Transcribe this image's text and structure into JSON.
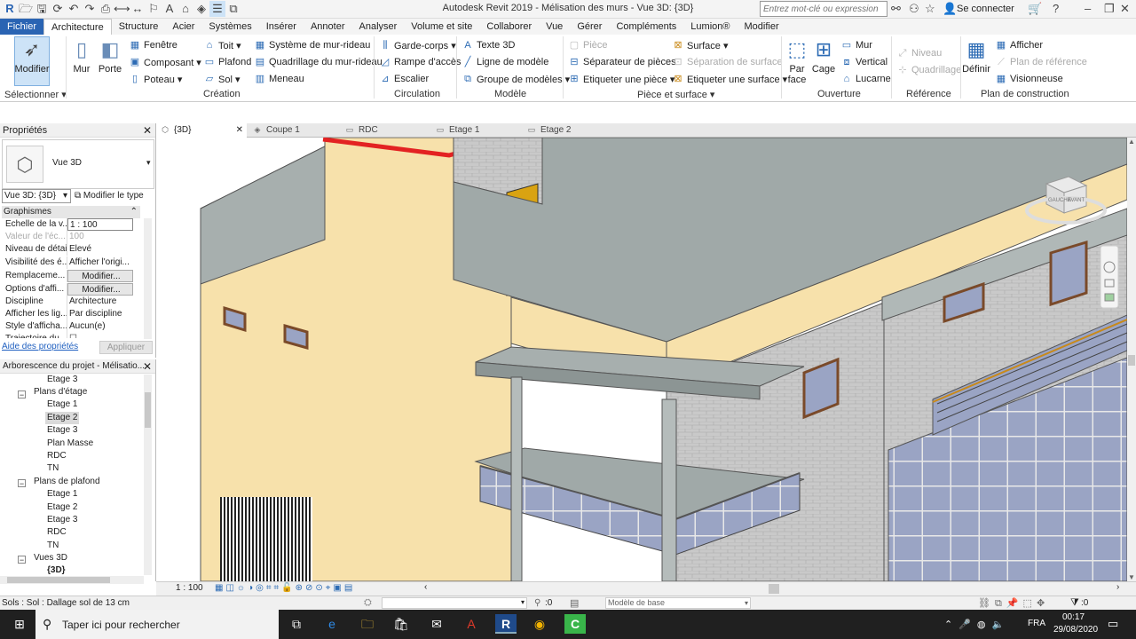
{
  "app": {
    "title": "Autodesk Revit 2019 - Mélisation des murs - Vue 3D: {3D}",
    "search_placeholder": "Entrez mot-clé ou expression",
    "signin": "Se connecter"
  },
  "menu_tabs": [
    "Fichier",
    "Architecture",
    "Structure",
    "Acier",
    "Systèmes",
    "Insérer",
    "Annoter",
    "Analyser",
    "Volume et site",
    "Collaborer",
    "Vue",
    "Gérer",
    "Compléments",
    "Lumion®",
    "Modifier"
  ],
  "ribbon": {
    "select": {
      "modify": "Modifier",
      "label": "Sélectionner ▾"
    },
    "build": {
      "wall": "Mur",
      "door": "Porte",
      "window": "Fenêtre",
      "component": "Composant ▾",
      "column": "Poteau ▾",
      "roof": "Toit ▾",
      "ceiling": "Plafond",
      "floor": "Sol ▾",
      "curtain_system": "Système de mur-rideau",
      "curtain_grid": "Quadrillage du mur-rideau",
      "mullion": "Meneau",
      "label": "Création"
    },
    "circulation": {
      "railing": "Garde-corps ▾",
      "ramp": "Rampe d'accès",
      "stair": "Escalier",
      "label": "Circulation"
    },
    "model": {
      "model_text": "Texte 3D",
      "model_line": "Ligne de modèle",
      "model_group": "Groupe de modèles ▾",
      "label": "Modèle"
    },
    "room": {
      "room": "Pièce",
      "room_separator": "Séparateur de pièces",
      "tag_room": "Etiqueter une pièce ▾",
      "area": "Surface ▾",
      "area_boundary": "Séparation de surface",
      "tag_area": "Etiqueter une surface ▾",
      "label": "Pièce et surface ▾"
    },
    "opening": {
      "by_face": "Par face",
      "shaft": "Cage",
      "wall": "Mur",
      "vertical": "Vertical",
      "dormer": "Lucarne",
      "label": "Ouverture"
    },
    "datum": {
      "level": "Niveau",
      "grid": "Quadrillage",
      "label": "Référence"
    },
    "work_plane": {
      "set": "Définir",
      "show": "Afficher",
      "ref_plane": "Plan de référence",
      "viewer": "Visionneuse",
      "label": "Plan de construction"
    }
  },
  "properties": {
    "title": "Propriétés",
    "type_name": "Vue 3D",
    "instance_select": "Vue 3D: {3D}",
    "edit_type": "Modifier le type",
    "group": "Graphismes",
    "rows": [
      {
        "k": "Echelle de la v...",
        "v": "1 : 100"
      },
      {
        "k": "Valeur de l'éc...",
        "v": "100"
      },
      {
        "k": "Niveau de détail",
        "v": "Elevé"
      },
      {
        "k": "Visibilité des é...",
        "v": "Afficher l'origi..."
      },
      {
        "k": "Remplaceme...",
        "v": "Modifier..."
      },
      {
        "k": "Options d'affi...",
        "v": "Modifier..."
      },
      {
        "k": "Discipline",
        "v": "Architecture"
      },
      {
        "k": "Afficher les lig...",
        "v": "Par discipline"
      },
      {
        "k": "Style d'afficha...",
        "v": "Aucun(e)"
      },
      {
        "k": "Trajectoire du...",
        "v": ""
      }
    ],
    "help": "Aide des propriétés",
    "apply": "Appliquer"
  },
  "browser": {
    "title": "Arborescence du projet - Mélisatio...",
    "items": [
      {
        "label": "Etage 3",
        "level": 2
      },
      {
        "label": "Plans d'étage",
        "level": 1
      },
      {
        "label": "Etage 1",
        "level": 2
      },
      {
        "label": "Etage 2",
        "level": 2,
        "selected": true
      },
      {
        "label": "Etage 3",
        "level": 2
      },
      {
        "label": "Plan Masse",
        "level": 2
      },
      {
        "label": "RDC",
        "level": 2
      },
      {
        "label": "TN",
        "level": 2
      },
      {
        "label": "Plans de plafond",
        "level": 1
      },
      {
        "label": "Etage 1",
        "level": 2
      },
      {
        "label": "Etage 2",
        "level": 2
      },
      {
        "label": "Etage 3",
        "level": 2
      },
      {
        "label": "RDC",
        "level": 2
      },
      {
        "label": "TN",
        "level": 2
      },
      {
        "label": "Vues 3D",
        "level": 1
      },
      {
        "label": "{3D}",
        "level": 2,
        "bold": true
      }
    ]
  },
  "view_tabs": [
    "{3D}",
    "Coupe 1",
    "RDC",
    "Etage 1",
    "Etage 2"
  ],
  "viewcube": {
    "left": "GAUCHE",
    "front": "AVANT"
  },
  "view_control": {
    "scale": "1 : 100"
  },
  "status": {
    "text": "Sols : Sol : Dallage sol de 13 cm",
    "counter": ":0",
    "model": "Modèle de base",
    "filter": ":0"
  },
  "taskbar": {
    "search": "Taper ici pour rechercher",
    "lang": "FRA",
    "time": "00:17",
    "date": "29/08/2020"
  },
  "colors": {
    "file_tab": "#2a64b3",
    "plaster": "#f7e1ab",
    "slab": "#9aa4a3",
    "door": "#d9a312",
    "glass": "#9aa4c4"
  }
}
